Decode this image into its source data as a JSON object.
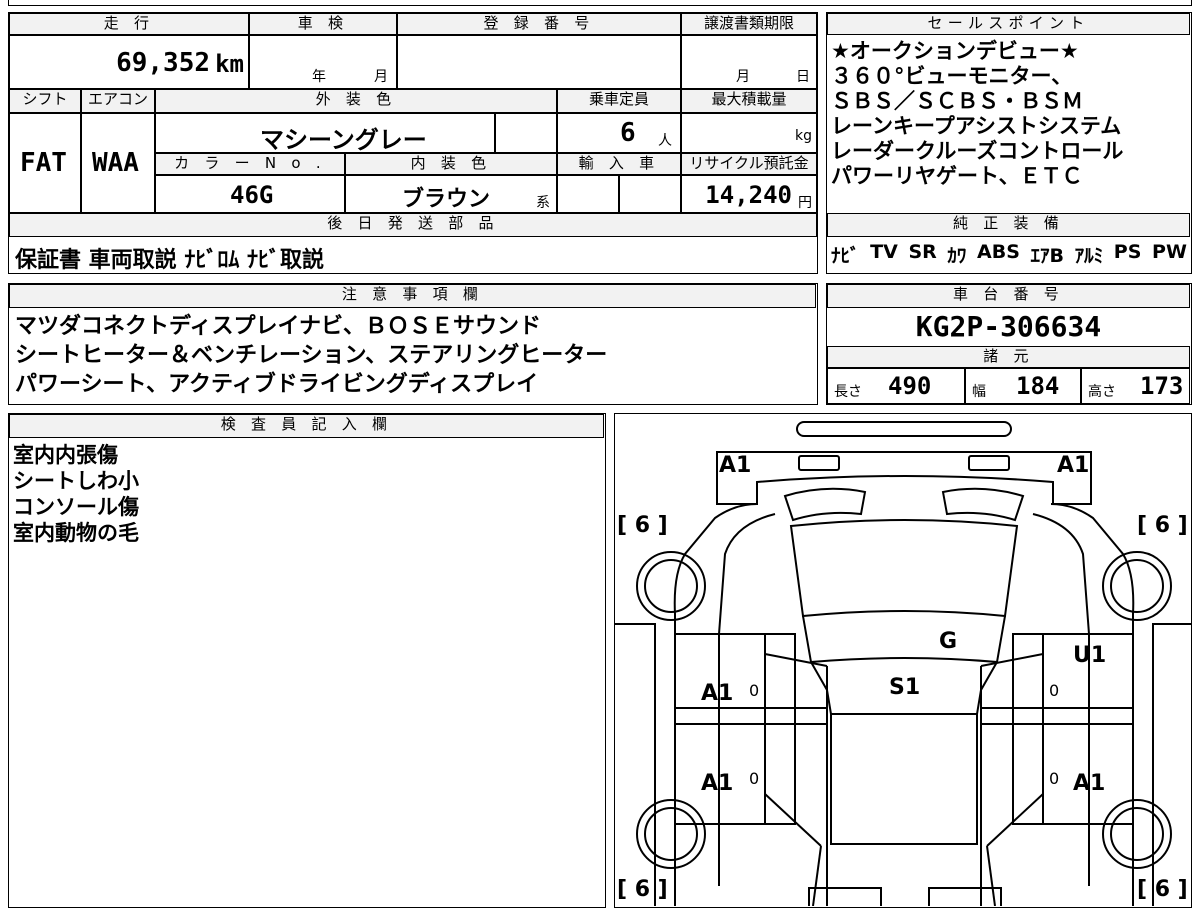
{
  "top_row": {
    "mileage_label": "走 行",
    "mileage_value": "69,352",
    "mileage_unit": "km",
    "inspection_label": "車 検",
    "inspection_year_unit": "年",
    "inspection_month_unit": "月",
    "registration_label": "登 録 番 号",
    "transfer_deadline_label": "譲渡書類期限",
    "transfer_month_unit": "月",
    "transfer_day_unit": "日"
  },
  "row2": {
    "shift_label": "シフト",
    "shift_value": "FAT",
    "aircon_label": "エアコン",
    "aircon_value": "WAA",
    "exterior_color_label": "外 装 色",
    "exterior_color_value": "マシーングレー",
    "capacity_label": "乗車定員",
    "capacity_value": "6",
    "capacity_unit": "人",
    "max_load_label": "最大積載量",
    "max_load_unit": "kg",
    "color_no_label": "カ ラ ー N o .",
    "color_no_value": "46G",
    "interior_color_label": "内 装 色",
    "interior_color_value": "ブラウン",
    "interior_color_suffix": "系",
    "import_label": "輸 入 車",
    "recycle_label": "リサイクル預託金",
    "recycle_value": "14,240",
    "recycle_unit": "円"
  },
  "later_parts": {
    "label": "後 日 発 送 部 品",
    "value": "保証書 車両取説 ﾅﾋﾞﾛﾑ ﾅﾋﾞ取説"
  },
  "sales_points": {
    "label": "セールスポイント",
    "lines": [
      "★オークションデビュー★",
      "３６０°ビューモニター、",
      "ＳＢＳ／ＳＣＢＳ・ＢＳＭ",
      "レーンキープアシストシステム",
      "レーダークルーズコントロール",
      "パワーリヤゲート、ＥＴＣ"
    ]
  },
  "genuine_equipment": {
    "label": "純 正 装 備",
    "items": [
      "ﾅﾋﾞ",
      "TV",
      "SR",
      "ｶﾜ",
      "ABS",
      "ｴｱB",
      "ｱﾙﾐ",
      "PS",
      "PW"
    ]
  },
  "notes": {
    "label": "注 意 事 項 欄",
    "lines": [
      "マツダコネクトディスプレイナビ、ＢＯＳＥサウンド",
      "シートヒーター＆ベンチレーション、ステアリングヒーター",
      "パワーシート、アクティブドライビングディスプレイ"
    ]
  },
  "chassis": {
    "label": "車 台 番 号",
    "value": "KG2P-306634"
  },
  "specs": {
    "label": "諸 元",
    "length_label": "長さ",
    "length_value": "490",
    "width_label": "幅",
    "width_value": "184",
    "height_label": "高さ",
    "height_value": "173"
  },
  "inspector": {
    "label": "検 査 員 記 入 欄",
    "lines": [
      "室内内張傷",
      "シートしわ小",
      "コンソール傷",
      "室内動物の毛"
    ]
  },
  "diagram": {
    "marks": {
      "rear_left": "A1",
      "rear_right": "A1",
      "tire_rear_left": "[ 6 ]",
      "tire_rear_right": "[ 6 ]",
      "tire_front_left": "[ 6 ]",
      "tire_front_right": "[ 6 ]",
      "glass": "G",
      "seat": "S1",
      "right_rear_door": "U1",
      "left_rear_door": "A1",
      "left_front_door": "A1",
      "right_front_door": "A1",
      "zero_marks": [
        "0",
        "0",
        "0",
        "0"
      ]
    }
  }
}
